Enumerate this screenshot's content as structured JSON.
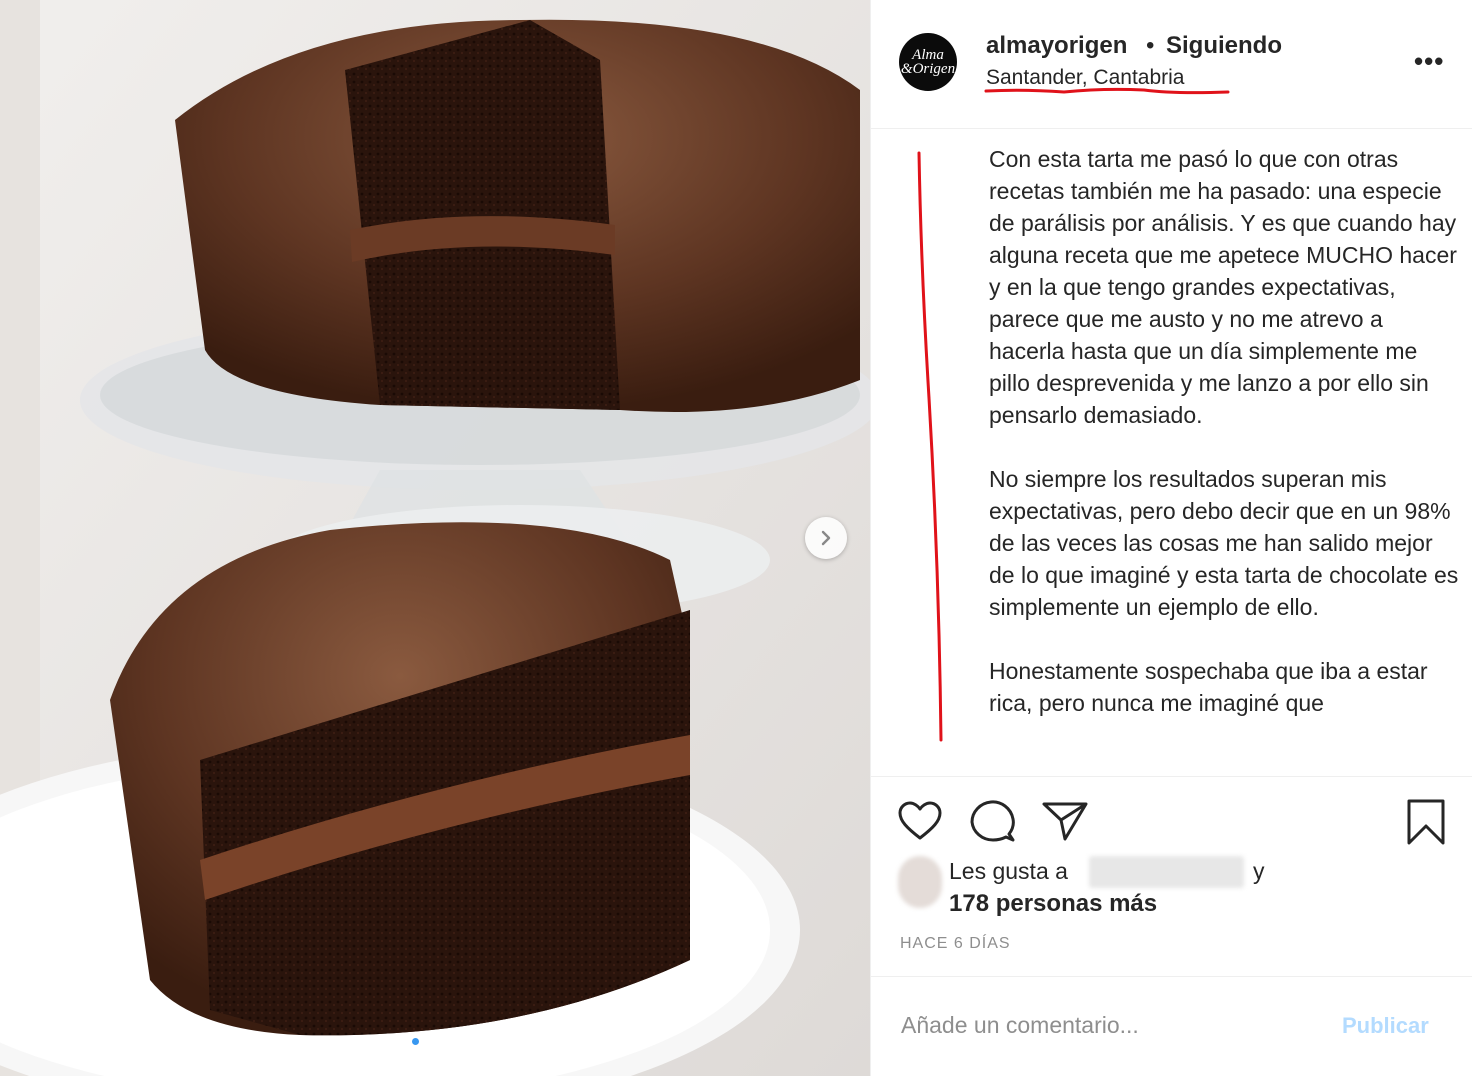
{
  "post": {
    "image_alt": "Chocolate layer cake with a slice cut out",
    "next_icon": "chevron-right-icon",
    "carousel": {
      "count": 2,
      "active": 0
    }
  },
  "header": {
    "avatar_text_1": "Alma",
    "avatar_text_2": "&Origen",
    "username": "almayorigen",
    "separator": "•",
    "following": "Siguiendo",
    "location": "Santander, Cantabria",
    "more_icon": "ellipsis-icon",
    "more": "•••"
  },
  "caption": {
    "paragraphs": [
      "Con esta tarta me pasó lo que con otras recetas también me ha pasado: una especie de parálisis por análisis. Y es que cuando hay alguna receta que me apetece MUCHO hacer y en la que tengo grandes expectativas, parece que me austo y no me atrevo a hacerla hasta que un día simplemente me pillo desprevenida y me lanzo a por ello sin pensarlo demasiado.",
      "No siempre los resultados superan mis expectativas, pero debo decir que en un 98% de las veces las cosas me han salido mejor de lo que imaginé y esta tarta de chocolate es simplemente un ejemplo de ello.",
      "Honestamente sospechaba que iba a estar rica, pero nunca me imaginé que"
    ]
  },
  "actions": {
    "like_icon": "heart-icon",
    "comment_icon": "comment-bubble-icon",
    "share_icon": "paper-plane-icon",
    "save_icon": "bookmark-icon"
  },
  "likes": {
    "prefix": "Les gusta a",
    "and": "y",
    "count_text": "178 personas más"
  },
  "timestamp": "HACE 6 DÍAS",
  "comment": {
    "placeholder": "Añade un comentario...",
    "publish": "Publicar"
  },
  "colors": {
    "annotation_red": "#e0121a",
    "publish_disabled": "#b3dbff",
    "muted": "#8e8e8e",
    "text": "#262626"
  }
}
